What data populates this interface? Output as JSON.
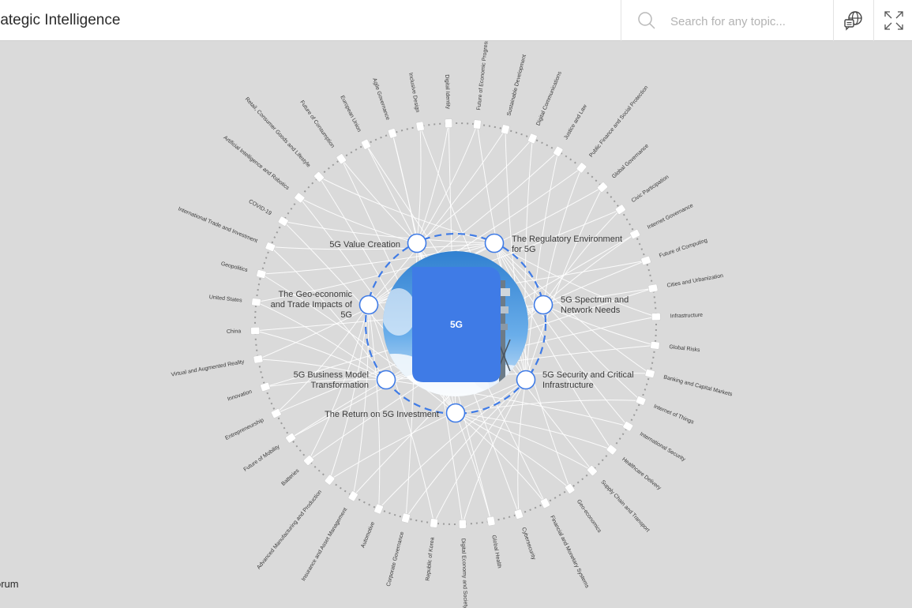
{
  "header": {
    "title": "rategic Intelligence",
    "search_placeholder": "Search for any topic..."
  },
  "icons": {
    "search": "search-icon",
    "language": "globe-chat-icon",
    "expand": "expand-icon"
  },
  "colors": {
    "background": "#dadada",
    "accent": "#3f7be6",
    "ring": "#9a9a9a",
    "link": "#ffffff"
  },
  "center": {
    "label": "5G"
  },
  "key_issues": [
    {
      "id": "value-creation",
      "label": "5G Value Creation"
    },
    {
      "id": "regulatory",
      "label": "The Regulatory Environment for 5G"
    },
    {
      "id": "spectrum",
      "label": "5G Spectrum and Network Needs"
    },
    {
      "id": "security",
      "label": "5G Security and Critical Infrastructure"
    },
    {
      "id": "return",
      "label": "The Return on 5G Investment"
    },
    {
      "id": "business-model",
      "label": "5G Business Model Transformation"
    },
    {
      "id": "geo-economic",
      "label": "The Geo-economic and Trade Impacts of 5G"
    }
  ],
  "topics": [
    {
      "label": "Digital Identity"
    },
    {
      "label": "Future of Economic Progress"
    },
    {
      "label": "Sustainable Development"
    },
    {
      "label": "Digital Communications"
    },
    {
      "label": "Justice and Law"
    },
    {
      "label": "Public Finance and Social Protection"
    },
    {
      "label": "Global Governance"
    },
    {
      "label": "Civic Participation"
    },
    {
      "label": "Internet Governance"
    },
    {
      "label": "Future of Computing"
    },
    {
      "label": "Cities and Urbanization"
    },
    {
      "label": "Infrastructure"
    },
    {
      "label": "Global Risks"
    },
    {
      "label": "Banking and Capital Markets"
    },
    {
      "label": "Internet of Things"
    },
    {
      "label": "International Security"
    },
    {
      "label": "Healthcare Delivery"
    },
    {
      "label": "Supply Chain and Transport"
    },
    {
      "label": "Geo-economics"
    },
    {
      "label": "Financial and Monetary Systems"
    },
    {
      "label": "Cybersecurity"
    },
    {
      "label": "Global Health"
    },
    {
      "label": "Digital Economy and Society"
    },
    {
      "label": "Republic of Korea"
    },
    {
      "label": "Corporate Governance"
    },
    {
      "label": "Automotive"
    },
    {
      "label": "Insurance and Asset Management"
    },
    {
      "label": "Advanced Manufacturing and Production"
    },
    {
      "label": "Batteries"
    },
    {
      "label": "Future of Mobility"
    },
    {
      "label": "Entrepreneurship"
    },
    {
      "label": "Innovation"
    },
    {
      "label": "Virtual and Augmented Reality"
    },
    {
      "label": "China"
    },
    {
      "label": "United States"
    },
    {
      "label": "Geopolitics"
    },
    {
      "label": "International Trade and Investment"
    },
    {
      "label": "COVID-19"
    },
    {
      "label": "Artificial Intelligence and Robotics"
    },
    {
      "label": "Retail, Consumer Goods and Lifestyle"
    },
    {
      "label": "Future of Consumption"
    },
    {
      "label": "European Union"
    },
    {
      "label": "Agile Governance"
    },
    {
      "label": "Inclusive Design"
    }
  ],
  "footer": {
    "text": "orum"
  }
}
